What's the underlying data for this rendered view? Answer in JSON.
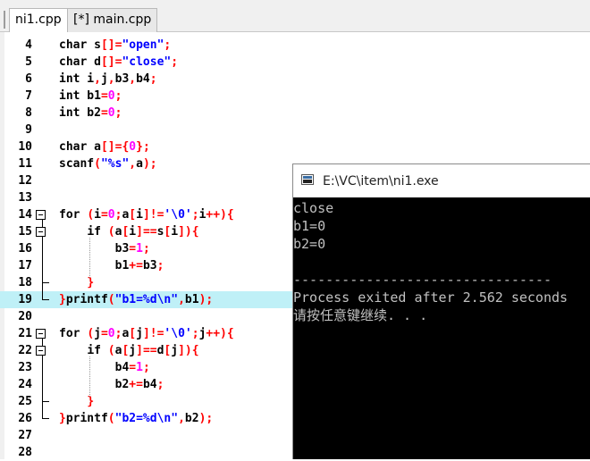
{
  "tabs": [
    {
      "label": "ni1.cpp",
      "active": true
    },
    {
      "label": "[*] main.cpp",
      "active": false
    }
  ],
  "editor": {
    "highlighted_line": 19,
    "lines": [
      {
        "num": "4",
        "code": "char s[]=\"open\";"
      },
      {
        "num": "5",
        "code": "char d[]=\"close\";"
      },
      {
        "num": "6",
        "code": "int i,j,b3,b4;"
      },
      {
        "num": "7",
        "code": "int b1=0;"
      },
      {
        "num": "8",
        "code": "int b2=0;"
      },
      {
        "num": "9",
        "code": ""
      },
      {
        "num": "10",
        "code": "char a[]={0};"
      },
      {
        "num": "11",
        "code": "scanf(\"%s\",a);"
      },
      {
        "num": "12",
        "code": ""
      },
      {
        "num": "13",
        "code": ""
      },
      {
        "num": "14",
        "code": "for (i=0;a[i]!='\\0';i++){"
      },
      {
        "num": "15",
        "code": "    if (a[i]==s[i]){"
      },
      {
        "num": "16",
        "code": "        b3=1;"
      },
      {
        "num": "17",
        "code": "        b1+=b3;"
      },
      {
        "num": "18",
        "code": "    }"
      },
      {
        "num": "19",
        "code": "}printf(\"b1=%d\\n\",b1);"
      },
      {
        "num": "20",
        "code": ""
      },
      {
        "num": "21",
        "code": "for (j=0;a[j]!='\\0';j++){"
      },
      {
        "num": "22",
        "code": "    if (a[j]==d[j]){"
      },
      {
        "num": "23",
        "code": "        b4=1;"
      },
      {
        "num": "24",
        "code": "        b2+=b4;"
      },
      {
        "num": "25",
        "code": "    }"
      },
      {
        "num": "26",
        "code": "}printf(\"b2=%d\\n\",b2);"
      },
      {
        "num": "27",
        "code": ""
      },
      {
        "num": "28",
        "code": ""
      }
    ]
  },
  "console": {
    "title": "E:\\VC\\item\\ni1.exe",
    "output": [
      "close",
      "b1=0",
      "b2=0",
      "",
      "--------------------------------",
      "Process exited after 2.562 seconds",
      "请按任意键继续. . ."
    ]
  },
  "colors": {
    "keyword": "#000000",
    "string": "#0000ff",
    "number": "#ff00ff",
    "symbol": "#ff0000",
    "highlight": "#bff0f7",
    "console_bg": "#000000",
    "console_text": "#c0c0c0"
  },
  "icons": {
    "console": "console-window-icon",
    "fold": "fold-minus-icon"
  }
}
